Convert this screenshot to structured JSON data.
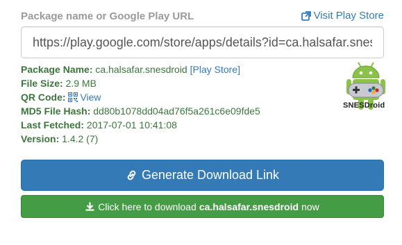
{
  "header": {
    "label": "Package name or Google Play URL",
    "visit_link": "Visit Play Store",
    "link_icon": "external-link-icon"
  },
  "url_input": {
    "value": "https://play.google.com/store/apps/details?id=ca.halsafar.snesdroid"
  },
  "info": {
    "package_name_key": "Package Name:",
    "package_name_value": "ca.halsafar.snesdroid",
    "play_store_link": "[Play Store]",
    "file_size_key": "File Size:",
    "file_size_value": "2.9 MB",
    "qr_code_key": "QR Code:",
    "qr_code_link": "View",
    "md5_key": "MD5 File Hash:",
    "md5_value": "dd80b1078dd04ad76f5a261c6e09fde5",
    "last_fetched_key": "Last Fetched:",
    "last_fetched_value": "2017-07-01 10:41:08",
    "version_key": "Version:",
    "version_value": "1.4.2 (7)"
  },
  "app": {
    "icon_text": "SNESDroid",
    "icon_name": "android-controller-icon"
  },
  "buttons": {
    "generate_label": "Generate Download Link",
    "download_prefix": "Click here to download",
    "download_package": "ca.halsafar.snesdroid",
    "download_suffix": "now"
  },
  "colors": {
    "primary": "#337ab7",
    "success": "#449d44",
    "info_text": "#3c763d",
    "label_gray": "#9a9a9a"
  }
}
